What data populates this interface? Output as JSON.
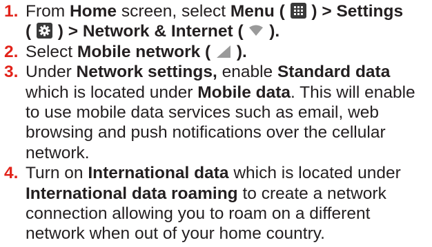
{
  "steps": [
    {
      "num": "1.",
      "t1": "From ",
      "home": "Home",
      "t2": " screen, select ",
      "menu": "Menu",
      "t3": " ( ",
      "t4": " ) > Settings",
      "t5": "( ",
      "t6": " ) > Network & Internet",
      "t7": " ( ",
      "t8": " )."
    },
    {
      "num": "2.",
      "t1": "Select ",
      "mobile_network": "Mobile network",
      "t2": " ( ",
      "t3": " )."
    },
    {
      "num": "3.",
      "t1": "Under ",
      "network_settings": "Network settings,",
      "t2": " enable ",
      "standard_data": "Standard data",
      "t3": " which is located under ",
      "mobile_data": "Mobile data",
      "t4": ". This will enable to use mobile data services such as email, web browsing and push notifications over the cellular network."
    },
    {
      "num": "4.",
      "t1": "Turn on ",
      "international_data": "International data",
      "t2": " which is located under ",
      "international_roaming": "International data roaming",
      "t3": " to create a network connection allowing you to roam on a different network when out of your home country."
    }
  ],
  "icons": {
    "menu": "apps-grid-icon",
    "settings": "gear-icon",
    "network": "wifi-icon",
    "mobile": "signal-icon"
  },
  "colors": {
    "step_number": "#e2231a",
    "text": "#231f20",
    "icon_dark": "#3a3a3a",
    "icon_gray": "#9a9a9a"
  }
}
